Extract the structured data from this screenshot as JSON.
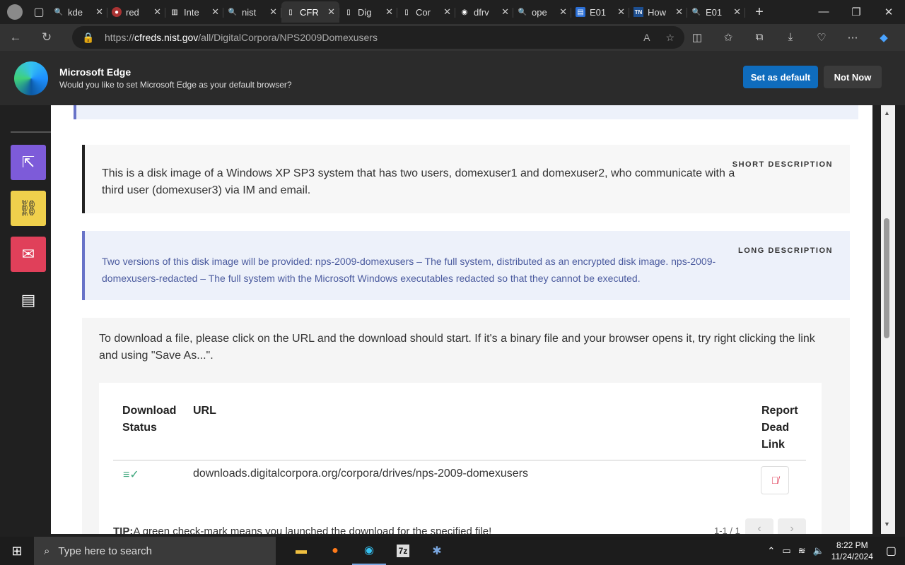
{
  "browser": {
    "tabs": [
      {
        "label": "kde",
        "icon": "search-icon",
        "active": false
      },
      {
        "label": "red",
        "icon": "reddit-icon",
        "active": false
      },
      {
        "label": "Inte",
        "icon": "archive-icon",
        "active": false
      },
      {
        "label": "nist",
        "icon": "search-icon",
        "active": false
      },
      {
        "label": "CFR",
        "icon": "page-icon",
        "active": true
      },
      {
        "label": "Dig",
        "icon": "page-icon",
        "active": false
      },
      {
        "label": "Cor",
        "icon": "page-icon",
        "active": false
      },
      {
        "label": "dfrv",
        "icon": "github-icon",
        "active": false
      },
      {
        "label": "ope",
        "icon": "search-icon",
        "active": false
      },
      {
        "label": "E01",
        "icon": "doc-icon",
        "active": false
      },
      {
        "label": "How",
        "icon": "tn-icon",
        "active": false
      },
      {
        "label": "E01",
        "icon": "search-red-icon",
        "active": false
      }
    ],
    "url_prefix": "https://",
    "url_host": "cfreds.nist.gov",
    "url_path": "/all/DigitalCorpora/NPS2009Domexusers"
  },
  "infobar": {
    "title": "Microsoft Edge",
    "message": "Would you like to set Microsoft Edge as your default browser?",
    "primary_button": "Set as default",
    "secondary_button": "Not Now"
  },
  "page": {
    "short_label": "SHORT DESCRIPTION",
    "short_text": "This is a disk image of a Windows XP SP3 system that has two users, domexuser1 and domexuser2, who communicate with a third user (domexuser3) via IM and email.",
    "long_label": "LONG DESCRIPTION",
    "long_text": "Two versions of this disk image will be provided: nps-2009-domexusers – The full system, distributed as an encrypted disk image. nps-2009-domexusers-redacted – The full system with the Microsoft Windows executables redacted so that they cannot be executed.",
    "download_intro": "To download a file, please click on the URL and the download should start. If it's a binary file and your browser opens it, try right clicking the link and using \"Save As...\".",
    "table": {
      "col_status_line1": "Download",
      "col_status_line2": "Status",
      "col_url": "URL",
      "col_report_line1": "Report",
      "col_report_line2": "Dead",
      "col_report_line3": "Link",
      "row_url": "downloads.digitalcorpora.org/corpora/drives/nps-2009-domexusers"
    },
    "tip_label": "TIP:",
    "tip_text": "A green check-mark means you launched the download for the specified file!",
    "pager": "1-1 / 1"
  },
  "taskbar": {
    "search_placeholder": "Type here to search",
    "time": "8:22 PM",
    "date": "11/24/2024"
  },
  "colors": {
    "edge_blue": "#0f6cbd",
    "share_purple": "#7d5bd9",
    "share_yellow": "#f0d04c",
    "share_red": "#e0405a",
    "long_accent": "#6873c8",
    "check_green": "#3aa57a"
  }
}
